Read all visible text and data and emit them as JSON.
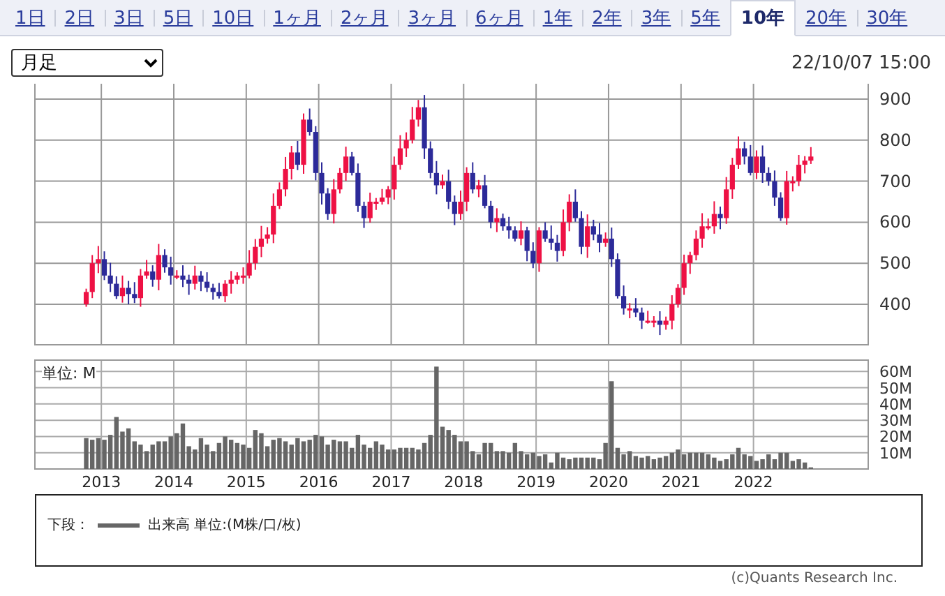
{
  "tabs": [
    {
      "label": "1日",
      "selected": false
    },
    {
      "label": "2日",
      "selected": false
    },
    {
      "label": "3日",
      "selected": false
    },
    {
      "label": "5日",
      "selected": false
    },
    {
      "label": "10日",
      "selected": false
    },
    {
      "label": "1ヶ月",
      "selected": false
    },
    {
      "label": "2ヶ月",
      "selected": false
    },
    {
      "label": "3ヶ月",
      "selected": false
    },
    {
      "label": "6ヶ月",
      "selected": false
    },
    {
      "label": "1年",
      "selected": false
    },
    {
      "label": "2年",
      "selected": false
    },
    {
      "label": "3年",
      "selected": false
    },
    {
      "label": "5年",
      "selected": false
    },
    {
      "label": "10年",
      "selected": true
    },
    {
      "label": "20年",
      "selected": false
    },
    {
      "label": "30年",
      "selected": false
    }
  ],
  "interval_select": {
    "value": "月足"
  },
  "timestamp": "22/10/07 15:00",
  "price_chart": {
    "axis_labels": [
      "900",
      "800",
      "700",
      "600",
      "500",
      "400"
    ]
  },
  "volume_chart": {
    "unit_label": "単位: M",
    "year_labels": [
      "2013",
      "2014",
      "2015",
      "2016",
      "2017",
      "2018",
      "2019",
      "2020",
      "2021",
      "2022"
    ],
    "chart_data": {
      "type": "bar",
      "grid": true,
      "ylim": [
        0,
        67
      ],
      "values": [
        null,
        null,
        null,
        null,
        null,
        null,
        null,
        null,
        19,
        18,
        19,
        18,
        21,
        32,
        23,
        25,
        17,
        15,
        11,
        15,
        17,
        17,
        20,
        22,
        28,
        14,
        12,
        19,
        15,
        11,
        16,
        20,
        18,
        16,
        15,
        13,
        24,
        22,
        14,
        18,
        19,
        17,
        15,
        19,
        17,
        18,
        21,
        20,
        15,
        18,
        17,
        17,
        13,
        21,
        15,
        13,
        17,
        15,
        12,
        12,
        13,
        13,
        13,
        12,
        16,
        21,
        63,
        26,
        24,
        21,
        17,
        17,
        11,
        9,
        16,
        16,
        11,
        11,
        10,
        16,
        11,
        9,
        10,
        8,
        9,
        4,
        10,
        7,
        6,
        7,
        7,
        7,
        7,
        6,
        16,
        54,
        13,
        9,
        11,
        8,
        7,
        8,
        6,
        7,
        8,
        10,
        12,
        9,
        10,
        10,
        10,
        9,
        7,
        5,
        6,
        9,
        13,
        9,
        8,
        5,
        6,
        9,
        6,
        10,
        10,
        5,
        6,
        4,
        1,
        null,
        null,
        null,
        null,
        null,
        null,
        null,
        null,
        null
      ],
      "yticks": [
        {
          "value": 10,
          "label": "10M"
        },
        {
          "value": 20,
          "label": "20M"
        },
        {
          "value": 30,
          "label": "30M"
        },
        {
          "value": 40,
          "label": "40M"
        },
        {
          "value": 50,
          "label": "50M"
        },
        {
          "value": 60,
          "label": "60M"
        }
      ]
    }
  },
  "legend": {
    "prefix": "下段：",
    "label": "出来高 単位:(M株/口/枚)"
  },
  "copyright": "(c)Quants Research Inc."
}
